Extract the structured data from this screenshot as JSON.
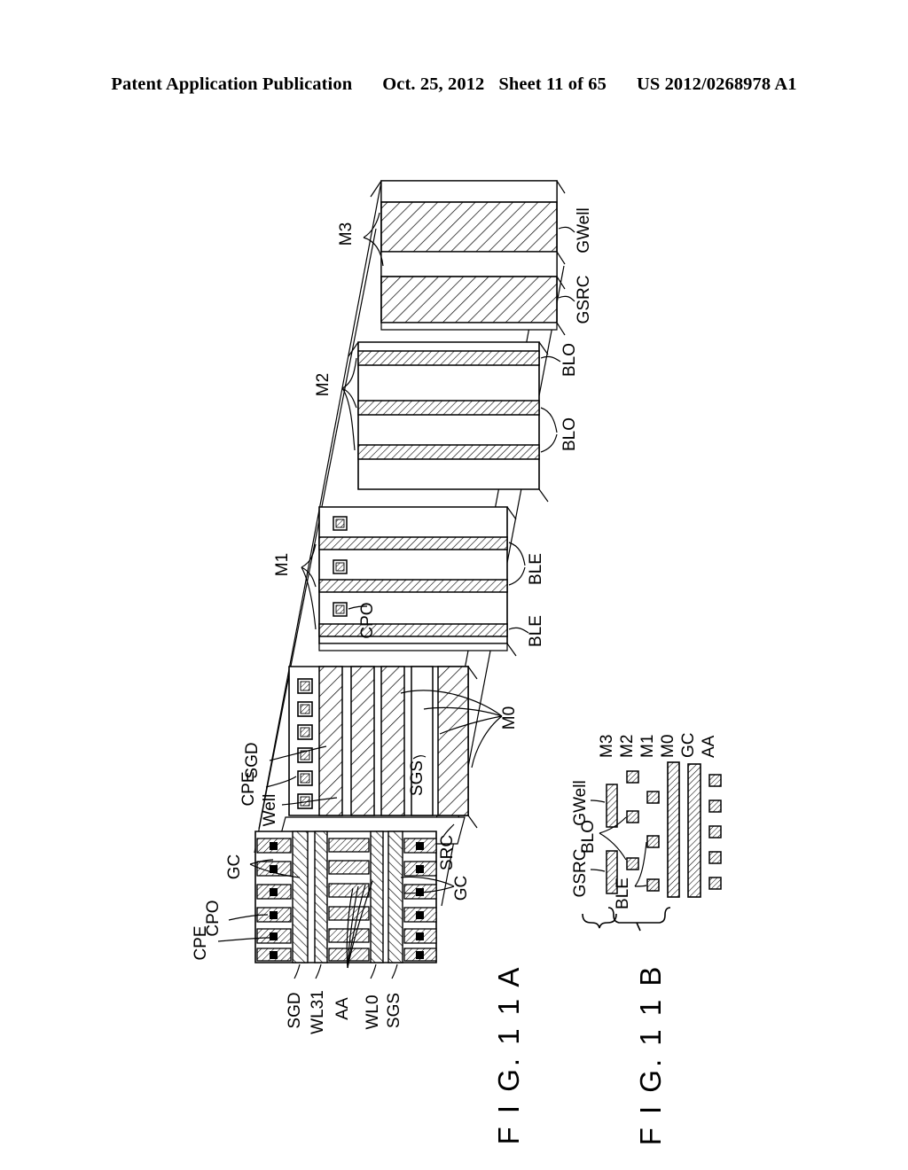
{
  "header": {
    "publication": "Patent Application Publication",
    "date": "Oct. 25, 2012",
    "sheet": "Sheet 11 of 65",
    "number": "US 2012/0268978 A1"
  },
  "figures": [
    {
      "id": "fig-11a",
      "caption": "F I G. 1 1 A"
    },
    {
      "id": "fig-11b",
      "caption": "F I G. 1 1 B"
    }
  ],
  "fig11a": {
    "caption": "F I G. 1 1 A",
    "layer_callouts": [
      {
        "name": "M3",
        "label": "M3"
      },
      {
        "name": "M2",
        "label": "M2"
      },
      {
        "name": "M1",
        "label": "M1"
      },
      {
        "name": "M0",
        "label": "M0"
      }
    ],
    "m3_layer": {
      "label": "M3",
      "bars": [
        {
          "name": "gwell-bar",
          "label": "GWell"
        },
        {
          "name": "gsrc-bar",
          "label": "GSRC"
        }
      ]
    },
    "m2_layer": {
      "label": "M2",
      "bars": [
        {
          "name": "blo-bar-1",
          "label": "BLO"
        },
        {
          "name": "blo-bar-2",
          "label": "BLO"
        },
        {
          "name": "blo-bar-3",
          "label": ""
        }
      ],
      "callout_labels": [
        "BLO",
        "BLO"
      ]
    },
    "m1_layer": {
      "label": "M1",
      "bars": [
        {
          "name": "ble-bar-1",
          "label": "BLE"
        },
        {
          "name": "ble-bar-2",
          "label": ""
        },
        {
          "name": "ble-bar-3",
          "label": "BLE"
        }
      ],
      "contacts_label": "CPO",
      "callout_labels": [
        "BLE",
        "BLE"
      ]
    },
    "m0_layer": {
      "label": "M0",
      "labels": [
        "CPE",
        "SGD",
        "Well",
        "SGS",
        "SRC"
      ],
      "cpe_label": "CPE",
      "sgd_label": "SGD",
      "well_label": "Well",
      "sgs_label": "SGS",
      "src_label": "SRC",
      "m0_label": "M0"
    },
    "aa_gc_layer": {
      "left_labels": [
        "CPE",
        "CPO",
        "GC"
      ],
      "right_labels": [
        "GC"
      ],
      "bottom_labels": [
        "SGD",
        "WL31",
        "AA",
        "WL0",
        "SGS"
      ],
      "cpe_label": "CPE",
      "cpo_label": "CPO",
      "gc_label_left": "GC",
      "gc_label_right": "GC"
    }
  },
  "fig11b": {
    "caption": "F I G. 1 1 B",
    "column_labels": [
      "M3",
      "M2",
      "M1",
      "M0",
      "GC",
      "AA"
    ],
    "item_labels": [
      "GSRC",
      "BLO",
      "GWell",
      "BLE"
    ],
    "gsrc_label": "GSRC",
    "blo_label": "BLO",
    "gwell_label": "GWell",
    "ble_label": "BLE",
    "m3_label": "M3",
    "m2_label": "M2",
    "m1_label": "M1",
    "m0_label": "M0",
    "gc_label": "GC",
    "aa_label": "AA"
  },
  "colors": {
    "ink": "#000000",
    "paper": "#ffffff"
  }
}
